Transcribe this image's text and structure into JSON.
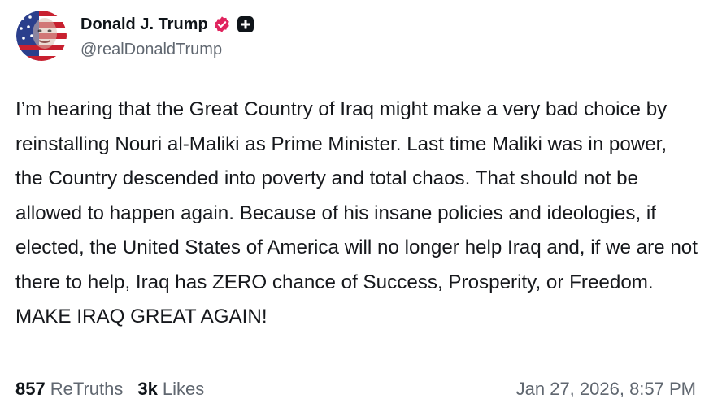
{
  "author": {
    "display_name": "Donald J. Trump",
    "handle": "@realDonaldTrump",
    "avatar_icon": "flag-face-avatar",
    "verified_icon": "verified-badge-icon",
    "verified_color": "#e0245e",
    "plus_icon": "add-plus-icon"
  },
  "post": {
    "text": "I’m hearing that the Great Country of Iraq might make a very bad choice by reinstalling Nouri al-Maliki as Prime Minister. Last time Maliki was in power, the Country descended into poverty and total chaos. That should not be allowed to happen again. Because of his insane policies and ideologies, if elected, the United States of America will no longer help Iraq and, if we are not there to help, Iraq has ZERO chance of Success, Prosperity, or Freedom. MAKE IRAQ GREAT AGAIN!"
  },
  "stats": {
    "retruths_count": "857",
    "retruths_label": "ReTruths",
    "likes_count": "3k",
    "likes_label": "Likes"
  },
  "timestamp": "Jan 27, 2026, 8:57 PM",
  "colors": {
    "text_primary": "#0f1419",
    "text_secondary": "#606770",
    "badge": "#e0245e"
  }
}
